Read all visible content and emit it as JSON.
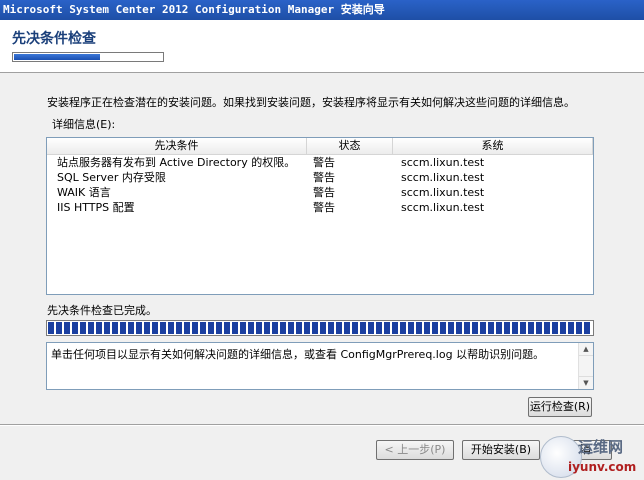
{
  "window": {
    "title": "Microsoft System Center 2012 Configuration Manager 安装向导"
  },
  "header": {
    "title": "先决条件检查",
    "progress": 0.58
  },
  "intro": "安装程序正在检查潜在的安装问题。如果找到安装问题，安装程序将显示有关如何解决这些问题的详细信息。",
  "details": {
    "label": "详细信息",
    "mnemonic": "(E)",
    "columns": [
      "先决条件",
      "状态",
      "系统"
    ],
    "rows": [
      {
        "prereq": "站点服务器有发布到 Active Directory 的权限。",
        "status": "警告",
        "system": "sccm.lixun.test"
      },
      {
        "prereq": "SQL Server 内存受限",
        "status": "警告",
        "system": "sccm.lixun.test"
      },
      {
        "prereq": "WAIK 语言",
        "status": "警告",
        "system": "sccm.lixun.test"
      },
      {
        "prereq": "IIS HTTPS 配置",
        "status": "警告",
        "system": "sccm.lixun.test"
      }
    ]
  },
  "check": {
    "status": "先决条件检查已完成。",
    "progress": 1.0
  },
  "description": "单击任何项目以显示有关如何解决问题的详细信息，或查看 ConfigMgrPrereq.log 以帮助识别问题。",
  "buttons": {
    "run_check": "运行检查(R)",
    "back": "< 上一步(P)",
    "begin_install": "开始安装(B)",
    "cancel": "取消"
  },
  "watermark": {
    "line1": "运维网",
    "line2": "iyunv.com"
  }
}
